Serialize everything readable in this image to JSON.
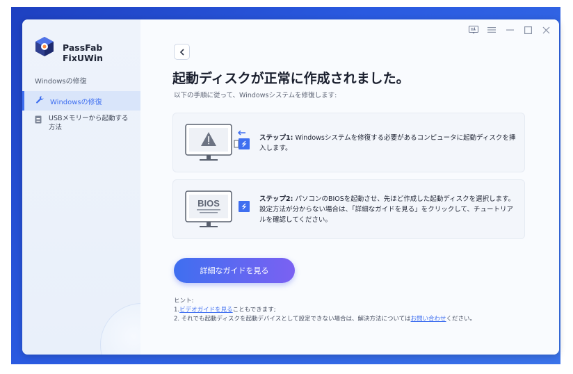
{
  "app": {
    "name": "PassFab FixUWin"
  },
  "sidebar": {
    "section_label": "Windowsの修復",
    "items": [
      {
        "label": "Windowsの修復",
        "icon": "wrench-icon",
        "active": true
      },
      {
        "label": "USBメモリーから起動する方法",
        "icon": "document-icon",
        "active": false
      }
    ]
  },
  "window_controls": [
    "feedback-icon",
    "menu-icon",
    "minimize-icon",
    "maximize-icon",
    "close-icon"
  ],
  "main": {
    "title": "起動ディスクが正常に作成されました。",
    "subtitle": "以下の手順に従って、Windowsシステムを修復します:",
    "steps": [
      {
        "label": "ステップ1:",
        "text": "Windowsシステムを修復する必要があるコンピュータに起動ディスクを挿入します。",
        "illustration": "monitor-warning-usb"
      },
      {
        "label": "ステップ2:",
        "text": "パソコンのBIOSを起動させ、先ほど作成した起動ディスクを選択します。設定方法が分からない場合は、「詳細なガイドを見る」をクリックして、チュートリアルを確認してください。",
        "illustration": "monitor-bios-usb",
        "bios_text": "BIOS"
      }
    ],
    "primary_button": "詳細なガイドを見る",
    "hints": {
      "heading": "ヒント:",
      "line1_prefix": "1.",
      "line1_link": "ビデオガイドを見る",
      "line1_suffix": "こともできます;",
      "line2_prefix": "2. それでも起動ディスクを起動デバイスとして設定できない場合は、解決方法については",
      "line2_link": "お問い合わせ",
      "line2_suffix": "ください。"
    }
  },
  "colors": {
    "accent": "#3f6ff0",
    "accent_gradient_end": "#7b61f2",
    "sidebar_bg": "#eef3fb",
    "desktop_bg": "#2a5ae0"
  }
}
